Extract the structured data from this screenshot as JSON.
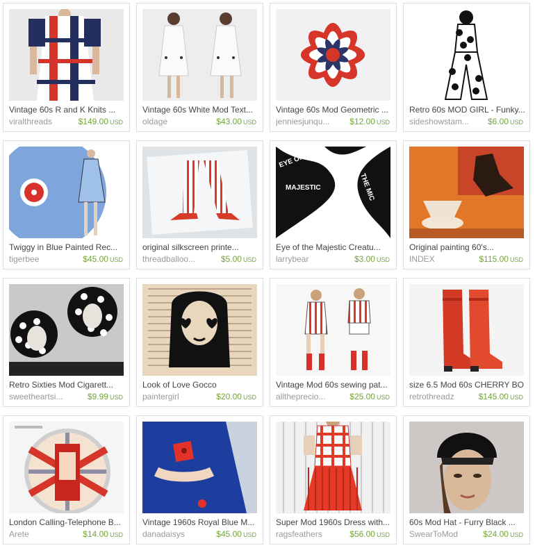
{
  "listings": [
    {
      "title": "Vintage 60s R and K Knits ...",
      "shop": "viralthreads",
      "price": "$149.00",
      "currency": "USD",
      "image": "red-white-navy-striped-dress"
    },
    {
      "title": "Vintage 60s White Mod Text...",
      "shop": "oldage",
      "price": "$43.00",
      "currency": "USD",
      "image": "white-mod-dress"
    },
    {
      "title": "Vintage 60s Mod Geometric ...",
      "shop": "jenniesjunqu...",
      "price": "$12.00",
      "currency": "USD",
      "image": "red-flower-scarf"
    },
    {
      "title": "Retro 60s MOD GIRL - Funky...",
      "shop": "sideshowstam...",
      "price": "$6.00",
      "currency": "USD",
      "image": "mod-girl-stamp"
    },
    {
      "title": "Twiggy in Blue Painted Rec...",
      "shop": "tigerbee",
      "price": "$45.00",
      "currency": "USD",
      "image": "twiggy-blue-record"
    },
    {
      "title": "original silkscreen printe...",
      "shop": "threadballoo...",
      "price": "$5.00",
      "currency": "USD",
      "image": "silkscreen-legs"
    },
    {
      "title": "Eye of the Majestic Creatu...",
      "shop": "larrybear",
      "price": "$3.00",
      "currency": "USD",
      "image": "typography-print"
    },
    {
      "title": "Original painting 60's...",
      "shop": "INDEX",
      "price": "$115.00",
      "currency": "USD",
      "image": "orange-painting"
    },
    {
      "title": "Retro Sixties Mod Cigarett...",
      "shop": "sweetheartsi...",
      "price": "$9.99",
      "currency": "USD",
      "image": "polka-dot-hoods"
    },
    {
      "title": "Look of Love Gocco",
      "shop": "paintergirl",
      "price": "$20.00",
      "currency": "USD",
      "image": "heart-glasses-girl"
    },
    {
      "title": "Vintage Mod 60s sewing pat...",
      "shop": "alltheprecio...",
      "price": "$25.00",
      "currency": "USD",
      "image": "sewing-pattern"
    },
    {
      "title": "size 6.5 Mod 60s CHERRY BO...",
      "shop": "retrothreadz",
      "price": "$145.00",
      "currency": "USD",
      "image": "red-boots"
    },
    {
      "title": "London Calling-Telephone B...",
      "shop": "Arete",
      "price": "$14.00",
      "currency": "USD",
      "image": "phone-box-pendant"
    },
    {
      "title": "Vintage 1960s Royal Blue M...",
      "shop": "danadaisys",
      "price": "$45.00",
      "currency": "USD",
      "image": "royal-blue-dress"
    },
    {
      "title": "Super Mod 1960s Dress with...",
      "shop": "ragsfeathers",
      "price": "$56.00",
      "currency": "USD",
      "image": "red-lattice-dress"
    },
    {
      "title": "60s Mod Hat - Furry Black ...",
      "shop": "SwearToMod",
      "price": "$24.00",
      "currency": "USD",
      "image": "black-fur-hat"
    }
  ],
  "colors": {
    "price": "#72a63a",
    "shop": "#999999",
    "title": "#444444",
    "border": "#dedede"
  }
}
